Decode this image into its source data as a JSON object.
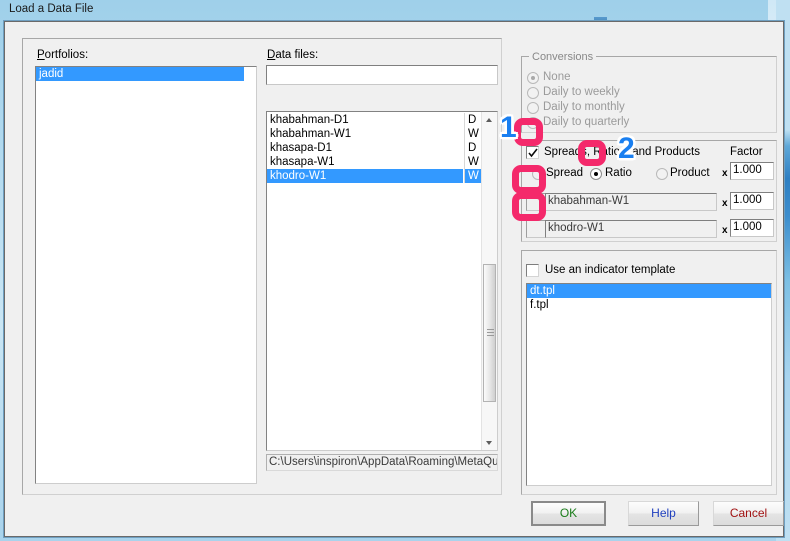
{
  "window": {
    "title": "Load a Data File"
  },
  "portfolios": {
    "label": "Portfolios:",
    "label_accel": "P",
    "items": [
      {
        "name": "jadid",
        "selected": true
      }
    ]
  },
  "data_files": {
    "label": "Data files:",
    "label_accel": "D",
    "filter_value": "",
    "filter_placeholder": "",
    "items": [
      {
        "name": "khabahman-D1",
        "period": "D",
        "selected": false
      },
      {
        "name": "khabahman-W1",
        "period": "W",
        "selected": false
      },
      {
        "name": "khasapa-D1",
        "period": "D",
        "selected": false
      },
      {
        "name": "khasapa-W1",
        "period": "W",
        "selected": false
      },
      {
        "name": "khodro-W1",
        "period": "W",
        "selected": true
      }
    ],
    "path": "C:\\Users\\inspiron\\AppData\\Roaming\\MetaQuot"
  },
  "conversions": {
    "title": "Conversions",
    "enabled": false,
    "options": [
      {
        "label": "None",
        "checked": true
      },
      {
        "label": "Daily to weekly",
        "checked": false
      },
      {
        "label": "Daily to monthly",
        "checked": false
      },
      {
        "label": "Daily to quarterly",
        "checked": false
      }
    ]
  },
  "spreads": {
    "checkbox_label": "Spreads, Ratios, and Products",
    "checkbox_checked": true,
    "factor_header": "Factor",
    "mode_options": [
      {
        "label": "Spread",
        "checked": false
      },
      {
        "label": "Ratio",
        "checked": true
      },
      {
        "label": "Product",
        "checked": false
      }
    ],
    "multiply_symbol": "x",
    "mode_factor": "1.000",
    "rows": [
      {
        "index": "1",
        "symbol": "khabahman-W1",
        "factor": "1.000"
      },
      {
        "index": "2",
        "symbol": "khodro-W1",
        "factor": "1.000"
      }
    ]
  },
  "indicator_template": {
    "checkbox_label": "Use an indicator template",
    "checkbox_checked": false,
    "items": [
      {
        "name": "dt.tpl",
        "selected": true
      },
      {
        "name": "f.tpl",
        "selected": false
      }
    ]
  },
  "buttons": {
    "ok": "OK",
    "help": "Help",
    "cancel": "Cancel"
  },
  "annotations": {
    "step1": "1",
    "step2": "2",
    "row1": "1",
    "row2": "2",
    "highlight_color": "#f4296b",
    "number_color": "#1a7ff0"
  }
}
